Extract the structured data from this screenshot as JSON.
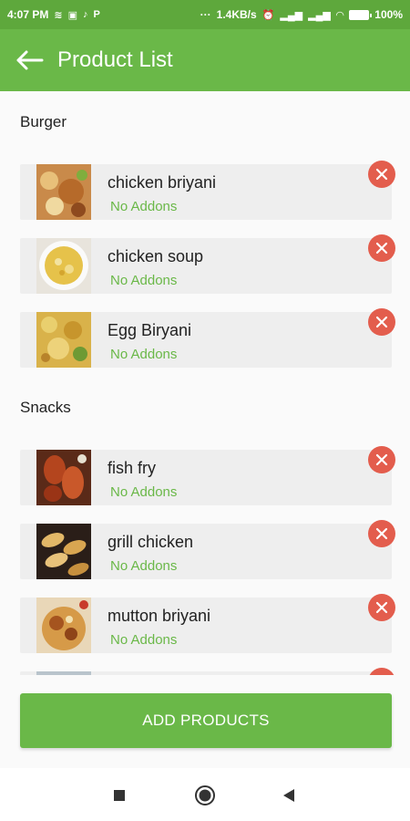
{
  "status_bar": {
    "time": "4:07 PM",
    "net_speed": "1.4KB/s",
    "battery": "100%"
  },
  "header": {
    "title": "Product List"
  },
  "sections": [
    {
      "title": "Burger",
      "items": [
        {
          "name": "chicken briyani",
          "addons": "No Addons"
        },
        {
          "name": "chicken soup",
          "addons": "No Addons"
        },
        {
          "name": "Egg Biryani",
          "addons": "No Addons"
        }
      ]
    },
    {
      "title": "Snacks",
      "items": [
        {
          "name": "fish fry",
          "addons": "No Addons"
        },
        {
          "name": "grill chicken",
          "addons": "No Addons"
        },
        {
          "name": "mutton briyani",
          "addons": "No Addons"
        }
      ]
    }
  ],
  "add_button": {
    "label": "ADD PRODUCTS"
  },
  "colors": {
    "primary": "#6ab848",
    "status_bar": "#5ea83c",
    "remove": "#e35d4d",
    "addon_text": "#6ab848"
  },
  "icons": {
    "back": "arrow-left-icon",
    "remove": "close-circle-icon",
    "nav": [
      "recents-square-icon",
      "home-circle-icon",
      "back-triangle-icon"
    ]
  }
}
